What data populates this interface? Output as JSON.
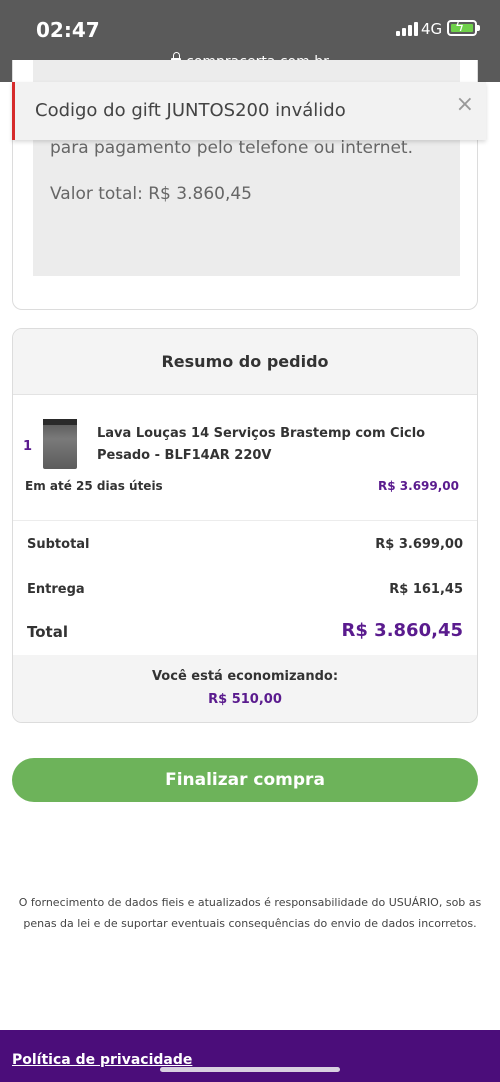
{
  "status_bar": {
    "time": "02:47",
    "network": "4G",
    "url": "compracerta.com.br"
  },
  "toast": {
    "message": "Codigo do gift JUNTOS200 inválido",
    "close": "×"
  },
  "payment_info": {
    "text": "para pagamento pelo telefone ou internet.",
    "total": "Valor total: R$ 3.860,45"
  },
  "summary": {
    "title": "Resumo do pedido",
    "item": {
      "quantity": "1",
      "name": "Lava Louças 14 Serviços Brastemp com Ciclo Pesado - BLF14AR 220V",
      "delivery": "Em até 25 dias úteis",
      "price": "R$ 3.699,00"
    },
    "subtotal_label": "Subtotal",
    "subtotal_value": "R$ 3.699,00",
    "shipping_label": "Entrega",
    "shipping_value": "R$ 161,45",
    "total_label": "Total",
    "total_value": "R$ 3.860,45",
    "saving_label": "Você está economizando:",
    "saving_value": "R$ 510,00"
  },
  "finalize_label": "Finalizar compra",
  "disclaimer": "O fornecimento de dados fieis e atualizados é responsabilidade do USUÁRIO, sob as penas da lei e de suportar eventuais consequências do envio de dados incorretos.",
  "footer": {
    "policy_link": "Política de privacidade"
  },
  "colors": {
    "brand_purple": "#5a1b8e",
    "footer_purple": "#4b0d7a",
    "button_green": "#6db35a",
    "error_red": "#d62b2b"
  }
}
